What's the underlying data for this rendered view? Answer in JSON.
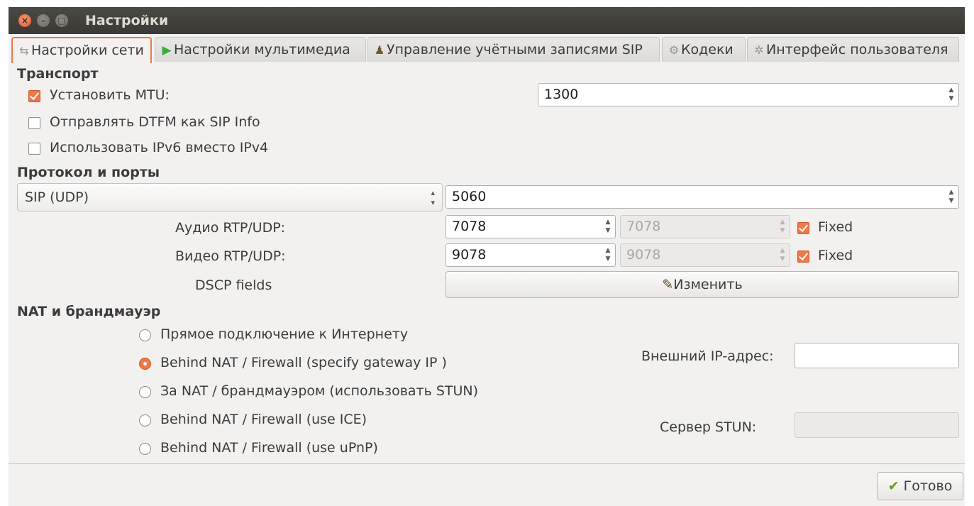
{
  "window": {
    "title": "Настройки"
  },
  "tabs": [
    {
      "label": "Настройки сети",
      "icon": "network-icon",
      "active": true
    },
    {
      "label": "Настройки мультимедиа",
      "icon": "play-icon"
    },
    {
      "label": "Управление учётными записями SIP",
      "icon": "accounts-icon"
    },
    {
      "label": "Кодеки",
      "icon": "codec-icon"
    },
    {
      "label": "Интерфейс пользователя",
      "icon": "ui-gear-icon"
    }
  ],
  "transport": {
    "heading": "Транспорт",
    "mtu_label": "Установить MTU:",
    "mtu_checked": true,
    "mtu_value": "1300",
    "dtmf_label": "Отправлять DTFM как SIP Info",
    "dtmf_checked": false,
    "ipv6_label": "Использовать IPv6 вместо IPv4",
    "ipv6_checked": false
  },
  "ports": {
    "heading": "Протокол и порты",
    "protocol_selected": "SIP (UDP)",
    "sip_port": "5060",
    "audio_label": "Аудио RTP/UDP:",
    "audio_port": "7078",
    "audio_port_max": "7078",
    "audio_fixed_label": "Fixed",
    "audio_fixed": true,
    "video_label": "Видео RTP/UDP:",
    "video_port": "9078",
    "video_port_max": "9078",
    "video_fixed_label": "Fixed",
    "video_fixed": true,
    "dscp_label": "DSCP fields",
    "dscp_button": "Изменить"
  },
  "nat": {
    "heading": "NAT и брандмауэр",
    "options": [
      {
        "label": "Прямое подключение к Интернету",
        "checked": false
      },
      {
        "label": "Behind NAT / Firewall (specify gateway IP )",
        "checked": true
      },
      {
        "label": "За NAT / брандмауэром (использовать STUN)",
        "checked": false
      },
      {
        "label": "Behind NAT / Firewall (use ICE)",
        "checked": false
      },
      {
        "label": "Behind NAT / Firewall (use uPnP)",
        "checked": false
      }
    ],
    "external_ip_label": "Внешний IP-адрес:",
    "external_ip_value": "",
    "stun_label": "Сервер STUN:",
    "stun_value": ""
  },
  "footer": {
    "done_button": "Готово"
  },
  "colors": {
    "accent": "#f07746",
    "titlebar": "#3c3b37",
    "window_bg": "#f2f1f0"
  }
}
